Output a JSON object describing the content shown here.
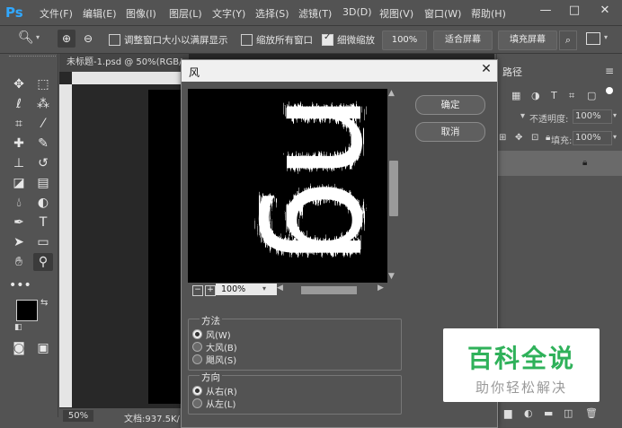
{
  "app": {
    "logo": "Ps"
  },
  "menu": [
    "文件(F)",
    "编辑(E)",
    "图像(I)",
    "图层(L)",
    "文字(Y)",
    "选择(S)",
    "滤镜(T)",
    "3D(D)",
    "视图(V)",
    "窗口(W)",
    "帮助(H)"
  ],
  "window_controls": {
    "minimize": "—",
    "maximize": "□",
    "close": "✕"
  },
  "options_bar": {
    "resize_window_label": "调整窗口大小以满屏显示",
    "zoom_all_label": "缩放所有窗口",
    "scrubby_zoom_label": "细微缩放",
    "zoom_percent": "100%",
    "fit_screen": "适合屏幕",
    "fill_screen": "填充屏幕"
  },
  "document": {
    "tab_title": "未标题-1.psd @ 50%(RGB/",
    "status_zoom": "50%",
    "status_doc": "文档:937.5K/"
  },
  "right_panel": {
    "tab_paths": "路径",
    "opacity_label": "不透明度:",
    "opacity_value": "100%",
    "fill_label": "填充:",
    "fill_value": "100%"
  },
  "dialog": {
    "title": "风",
    "close": "✕",
    "ok": "确定",
    "cancel": "取消",
    "preview_zoom": "100%",
    "zoom_out": "−",
    "zoom_in": "+",
    "method_title": "方法",
    "methods": [
      "风(W)",
      "大风(B)",
      "飓风(S)"
    ],
    "method_selected": 0,
    "direction_title": "方向",
    "directions": [
      "从右(R)",
      "从左(L)"
    ],
    "direction_selected": 0,
    "preview_text": "ng"
  },
  "watermark": {
    "title": "百科全说",
    "subtitle": "助你轻松解决"
  },
  "colors": {
    "accent": "#31a8ff",
    "watermark_green": "#2fb15a",
    "panel_bg": "#535353"
  }
}
